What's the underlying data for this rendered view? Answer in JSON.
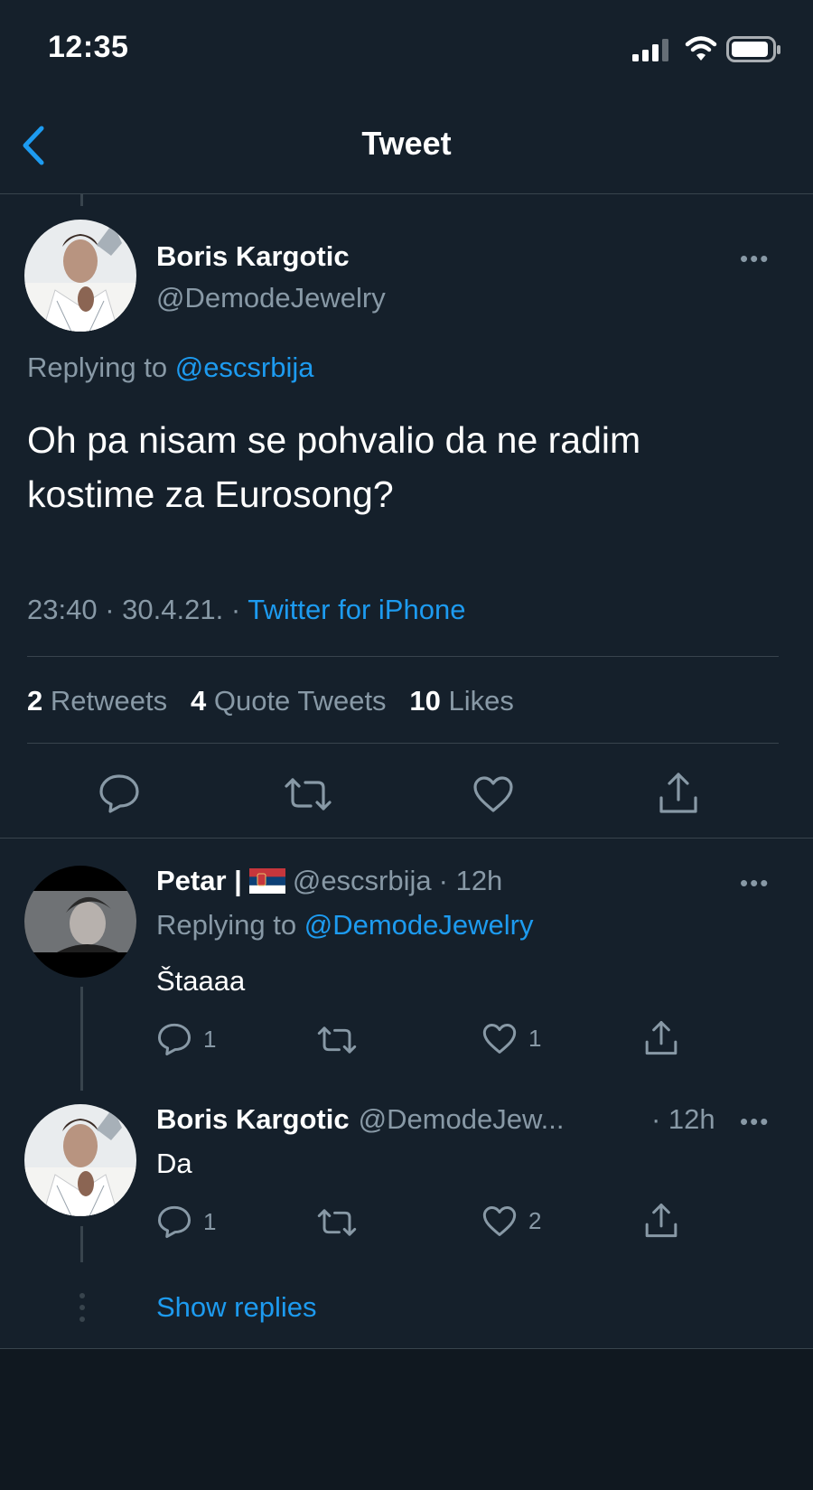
{
  "status_bar": {
    "time": "12:35"
  },
  "nav": {
    "title": "Tweet"
  },
  "main_tweet": {
    "name": "Boris Kargotic",
    "handle": "@DemodeJewelry",
    "replying_prefix": "Replying to",
    "replying_to": "@escsrbija",
    "text_line1": "Oh pa nisam se pohvalio da ne radim",
    "text_line2": "kostime za Eurosong?",
    "time": "23:40",
    "date": "30.4.21.",
    "dot": "·",
    "source": "Twitter for iPhone",
    "retweets_count": "2",
    "retweets_label": "Retweets",
    "quotes_count": "4",
    "quotes_label": "Quote Tweets",
    "likes_count": "10",
    "likes_label": "Likes"
  },
  "reply1": {
    "name": "Petar |",
    "handle": "@escsrbija",
    "time": "· 12h",
    "replying_prefix": "Replying to",
    "replying_to": "@DemodeJewelry",
    "text": "Štaaaa",
    "reply_count": "1",
    "like_count": "1"
  },
  "reply2": {
    "name": "Boris Kargotic",
    "handle": "@DemodeJew...",
    "time": "· 12h",
    "text": "Da",
    "reply_count": "1",
    "like_count": "2"
  },
  "show_replies": "Show replies",
  "colors": {
    "background": "#15202b",
    "accent": "#1d9bf0",
    "muted": "#8899a6",
    "border": "#38444d"
  }
}
